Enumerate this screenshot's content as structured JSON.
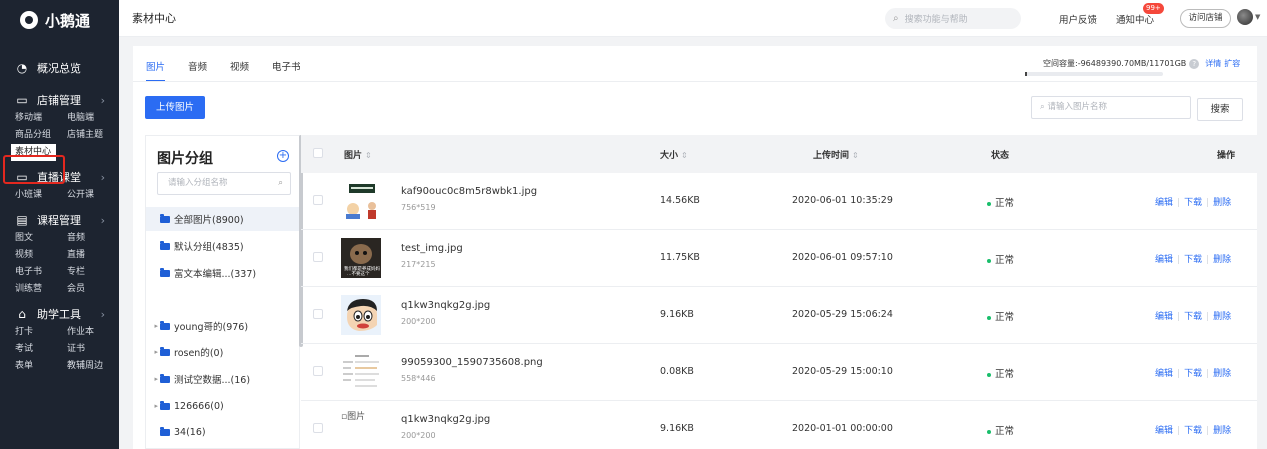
{
  "sidebar": {
    "logo": "小鹅通",
    "overview": "概况总览",
    "sections": [
      {
        "label": "店铺管理",
        "icon": "store-icon",
        "items": [
          "移动端",
          "电脑端",
          "商品分组",
          "店铺主题",
          "素材中心"
        ]
      },
      {
        "label": "直播课堂",
        "icon": "video-icon",
        "items": [
          "小班课",
          "公开课"
        ]
      },
      {
        "label": "课程管理",
        "icon": "course-icon",
        "items": [
          "图文",
          "音频",
          "视频",
          "直播",
          "电子书",
          "专栏",
          "训练营",
          "会员"
        ]
      },
      {
        "label": "助学工具",
        "icon": "tools-icon",
        "items": [
          "打卡",
          "作业本",
          "考试",
          "证书",
          "表单",
          "教辅周边"
        ]
      }
    ],
    "active_item": "素材中心"
  },
  "topbar": {
    "title": "素材中心",
    "search_placeholder": "搜索功能与帮助",
    "feedback": "用户反馈",
    "notice": "通知中心",
    "notice_badge": "99+",
    "visit_store": "访问店铺"
  },
  "main": {
    "tabs": [
      "图片",
      "音频",
      "视频",
      "电子书"
    ],
    "active_tab": "图片",
    "storage_label": "空间容量:",
    "storage_value": "-96489390.70MB/11701GB",
    "storage_detail": "详情",
    "storage_expand": "扩容",
    "upload_button": "上传图片",
    "image_search_placeholder": "请输入图片名称",
    "search_button": "搜索"
  },
  "groups": {
    "title": "图片分组",
    "search_placeholder": "请输入分组名称",
    "items": [
      {
        "label": "全部图片(8900)",
        "active": true,
        "expandable": false
      },
      {
        "label": "默认分组(4835)",
        "active": false,
        "expandable": false
      },
      {
        "label": "富文本编辑...(337)",
        "active": false,
        "expandable": false
      },
      {
        "label": "young哥的(976)",
        "active": false,
        "expandable": true
      },
      {
        "label": "rosen的(0)",
        "active": false,
        "expandable": true
      },
      {
        "label": "测试空数据...(16)",
        "active": false,
        "expandable": true
      },
      {
        "label": "126666(0)",
        "active": false,
        "expandable": true
      },
      {
        "label": "34(16)",
        "active": false,
        "expandable": false
      }
    ]
  },
  "table": {
    "headers": {
      "image": "图片",
      "size": "大小",
      "upload_time": "上传时间",
      "status": "状态",
      "actions": "操作"
    },
    "rows": [
      {
        "name": "kaf90ouc0c8m5r8wbk1.jpg",
        "dims": "756*519",
        "size": "14.56KB",
        "time": "2020-06-01 10:35:29",
        "status": "正常",
        "thumb": "slide"
      },
      {
        "name": "test_img.jpg",
        "dims": "217*215",
        "size": "11.75KB",
        "time": "2020-06-01 09:57:10",
        "status": "正常",
        "thumb": "meme",
        "thumb_caption": "我们都是养成妈妈",
        "thumb_caption2": "…不要这个"
      },
      {
        "name": "q1kw3nqkg2g.jpg",
        "dims": "200*200",
        "size": "9.16KB",
        "time": "2020-05-29 15:06:24",
        "status": "正常",
        "thumb": "cartoon"
      },
      {
        "name": "99059300_1590735608.png",
        "dims": "558*446",
        "size": "0.08KB",
        "time": "2020-05-29 15:00:10",
        "status": "正常",
        "thumb": "doc"
      },
      {
        "name": "q1kw3nqkg2g.jpg",
        "dims": "200*200",
        "size": "9.16KB",
        "time": "2020-01-01 00:00:00",
        "status": "正常",
        "thumb": "broken",
        "thumb_alt": "图片"
      }
    ],
    "actions": [
      "编辑",
      "下载",
      "删除"
    ]
  },
  "colors": {
    "primary": "#2b6cf3",
    "sidebar_bg": "#1d2430",
    "status_ok": "#19be6b",
    "highlight": "#e3281f"
  }
}
